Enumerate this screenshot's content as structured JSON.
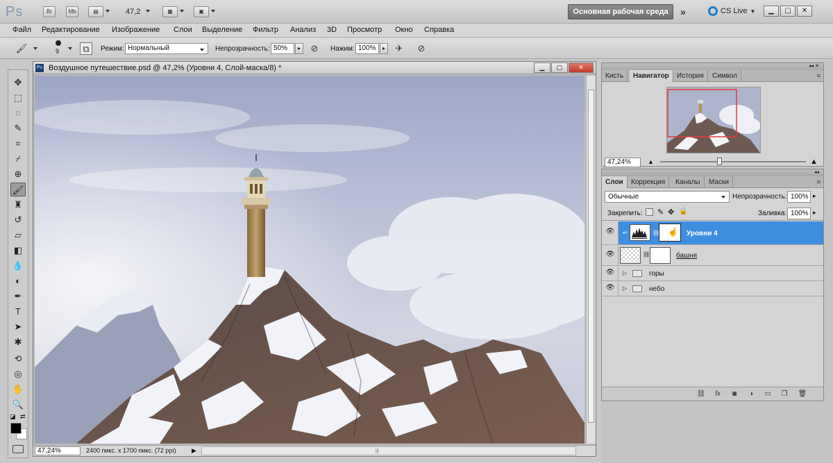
{
  "app": {
    "logo": "Ps",
    "bridge": "Br",
    "minibridge": "Mb",
    "zoom": "47,2",
    "workspace": "Основная рабочая среда",
    "cs_live": "CS Live"
  },
  "menu": [
    "Файл",
    "Редактирование",
    "Изображение",
    "Слои",
    "Выделение",
    "Фильтр",
    "Анализ",
    "3D",
    "Просмотр",
    "Окно",
    "Справка"
  ],
  "options": {
    "brush_size": "9",
    "mode_label": "Режим:",
    "mode_value": "Нормальный",
    "opacity_label": "Непрозрачность:",
    "opacity_value": "50%",
    "flow_label": "Нажим:",
    "flow_value": "100%"
  },
  "document": {
    "title": "Воздушное путешествие.psd @ 47,2% (Уровни 4, Слой-маска/8) *",
    "zoom": "47,24%",
    "info": "2400 пикс. x 1700 пикс. (72 ppi)"
  },
  "navigator": {
    "tabs": [
      "Кисть",
      "Навигатор",
      "История",
      "Символ"
    ],
    "active_tab": "Навигатор",
    "zoom": "47,24%"
  },
  "layers": {
    "tabs": [
      "Слои",
      "Коррекция",
      "Каналы",
      "Маски"
    ],
    "active_tab": "Слои",
    "blend_mode": "Обычные",
    "opacity_label": "Непрозрачность:",
    "opacity_value": "100%",
    "lock_label": "Закрепить:",
    "fill_label": "Заливка:",
    "fill_value": "100%",
    "items": [
      {
        "name": "Уровни 4",
        "type": "adjustment",
        "selected": true
      },
      {
        "name": "башня",
        "type": "layer",
        "selected": false
      },
      {
        "name": "горы",
        "type": "group",
        "selected": false
      },
      {
        "name": "небо",
        "type": "group",
        "selected": false
      }
    ]
  },
  "colors": {
    "accent": "#3d8ee0",
    "nav_view_rect": "#e43a3a"
  }
}
